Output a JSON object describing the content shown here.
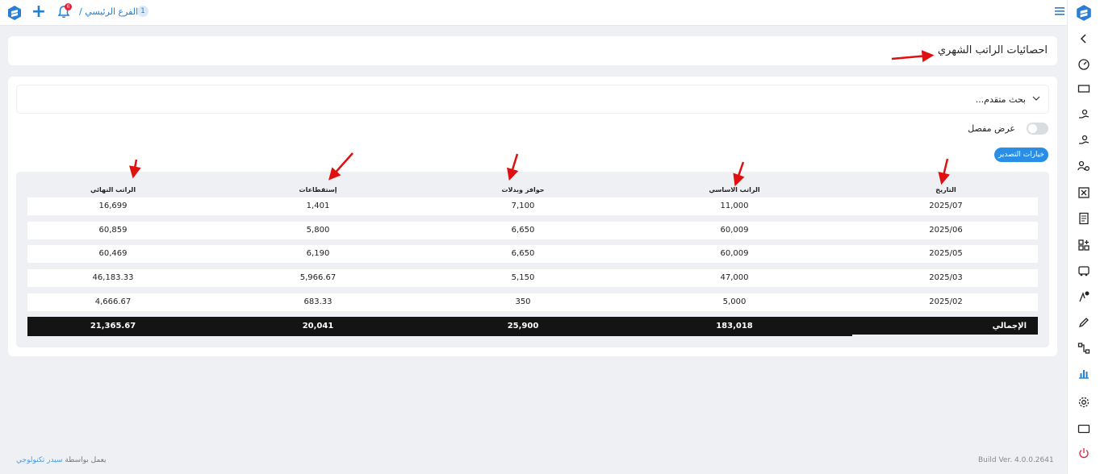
{
  "topbar": {
    "branch_label": "الفرع الرئيسي /",
    "branch_number": "1",
    "notification_count": "6"
  },
  "page": {
    "title": "احصائيات الراتب الشهري"
  },
  "filters": {
    "advanced_search_label": "بحث متقدم...",
    "detailed_view_label": "عرض مفصل",
    "export_options_label": "خيارات التصدير"
  },
  "table": {
    "headers": [
      "التاريخ",
      "الراتب الاساسي",
      "حوافز وبدلات",
      "إستقطاعات",
      "الراتب النهائي"
    ],
    "rows": [
      {
        "date": "2025/07",
        "basic": "11,000",
        "allowances": "7,100",
        "deductions": "1,401",
        "final": "16,699"
      },
      {
        "date": "2025/06",
        "basic": "60,009",
        "allowances": "6,650",
        "deductions": "5,800",
        "final": "60,859"
      },
      {
        "date": "2025/05",
        "basic": "60,009",
        "allowances": "6,650",
        "deductions": "6,190",
        "final": "60,469"
      },
      {
        "date": "2025/03",
        "basic": "47,000",
        "allowances": "5,150",
        "deductions": "5,966.67",
        "final": "46,183.33"
      },
      {
        "date": "2025/02",
        "basic": "5,000",
        "allowances": "350",
        "deductions": "683.33",
        "final": "4,666.67"
      }
    ],
    "total": {
      "label": "الإجمالي",
      "basic": "183,018",
      "allowances": "25,900",
      "deductions": "20,041",
      "final": "21,365.67"
    }
  },
  "footer": {
    "powered_by": "يعمل بواسطة",
    "brand": "سيدر تكنولوجي",
    "build": "Build Ver. 4.0.0.2641"
  },
  "colors": {
    "accent": "#1e7fd9",
    "total_bar": "#141414",
    "arrow": "#e01010"
  }
}
